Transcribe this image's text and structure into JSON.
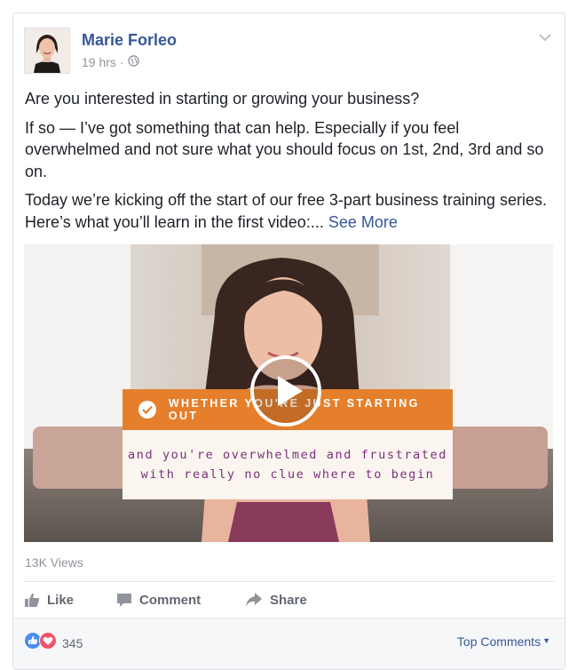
{
  "post": {
    "author": "Marie Forleo",
    "timestamp": "19 hrs",
    "separator": "·",
    "privacy_icon": "globe-icon",
    "body": {
      "p1": "Are you interested in starting or growing your business?",
      "p2": "If so — I’ve got something that can help. Especially if you feel overwhelmed and not sure what you should focus on 1st, 2nd, 3rd and so on.",
      "p3": "Today we’re kicking off the start of our free 3-part business training series. Here’s what you’ll learn in the first video:...",
      "see_more": "See More"
    },
    "video": {
      "overlay_top": "WHETHER YOU'RE JUST STARTING OUT",
      "overlay_line1": "and you're overwhelmed and frustrated",
      "overlay_line2": "with really no clue where to begin",
      "play_icon": "play-icon"
    },
    "views": "13K Views",
    "actions": {
      "like": "Like",
      "comment": "Comment",
      "share": "Share"
    },
    "reactions": {
      "count": "345",
      "icons": [
        "like-reaction-icon",
        "love-reaction-icon"
      ]
    },
    "top_comments": "Top Comments"
  },
  "colors": {
    "link": "#365899",
    "secondary_text": "#90949c",
    "action_text": "#616770",
    "overlay_orange": "#e57f2c",
    "overlay_purple": "#7a2f7a",
    "like_blue": "#4a8ef0",
    "love_red": "#f25268"
  }
}
